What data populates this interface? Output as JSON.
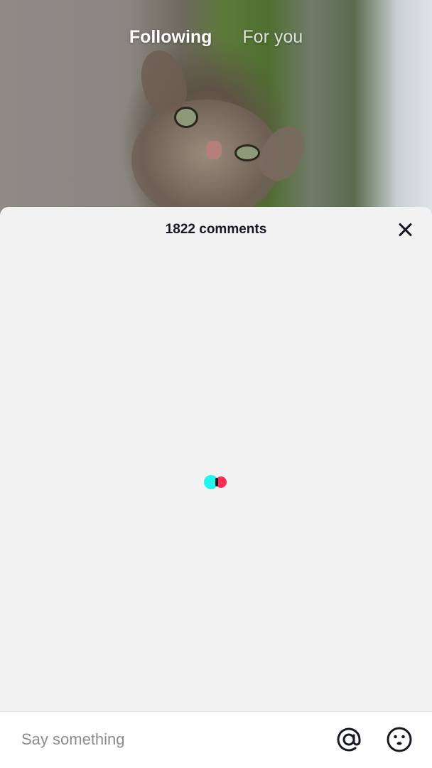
{
  "top_nav": {
    "tabs": [
      {
        "label": "Following",
        "active": true
      },
      {
        "label": "For you",
        "active": false
      }
    ]
  },
  "comments_sheet": {
    "title": "1822 comments",
    "comment_count": 1822,
    "close_icon": "close-icon",
    "loading": true,
    "loader_colors": {
      "cyan": "#25f4ee",
      "red": "#fe2c55"
    }
  },
  "input_bar": {
    "placeholder": "Say something",
    "value": "",
    "mention_icon": "at-sign-icon",
    "emoji_icon": "smiley-face-icon"
  }
}
